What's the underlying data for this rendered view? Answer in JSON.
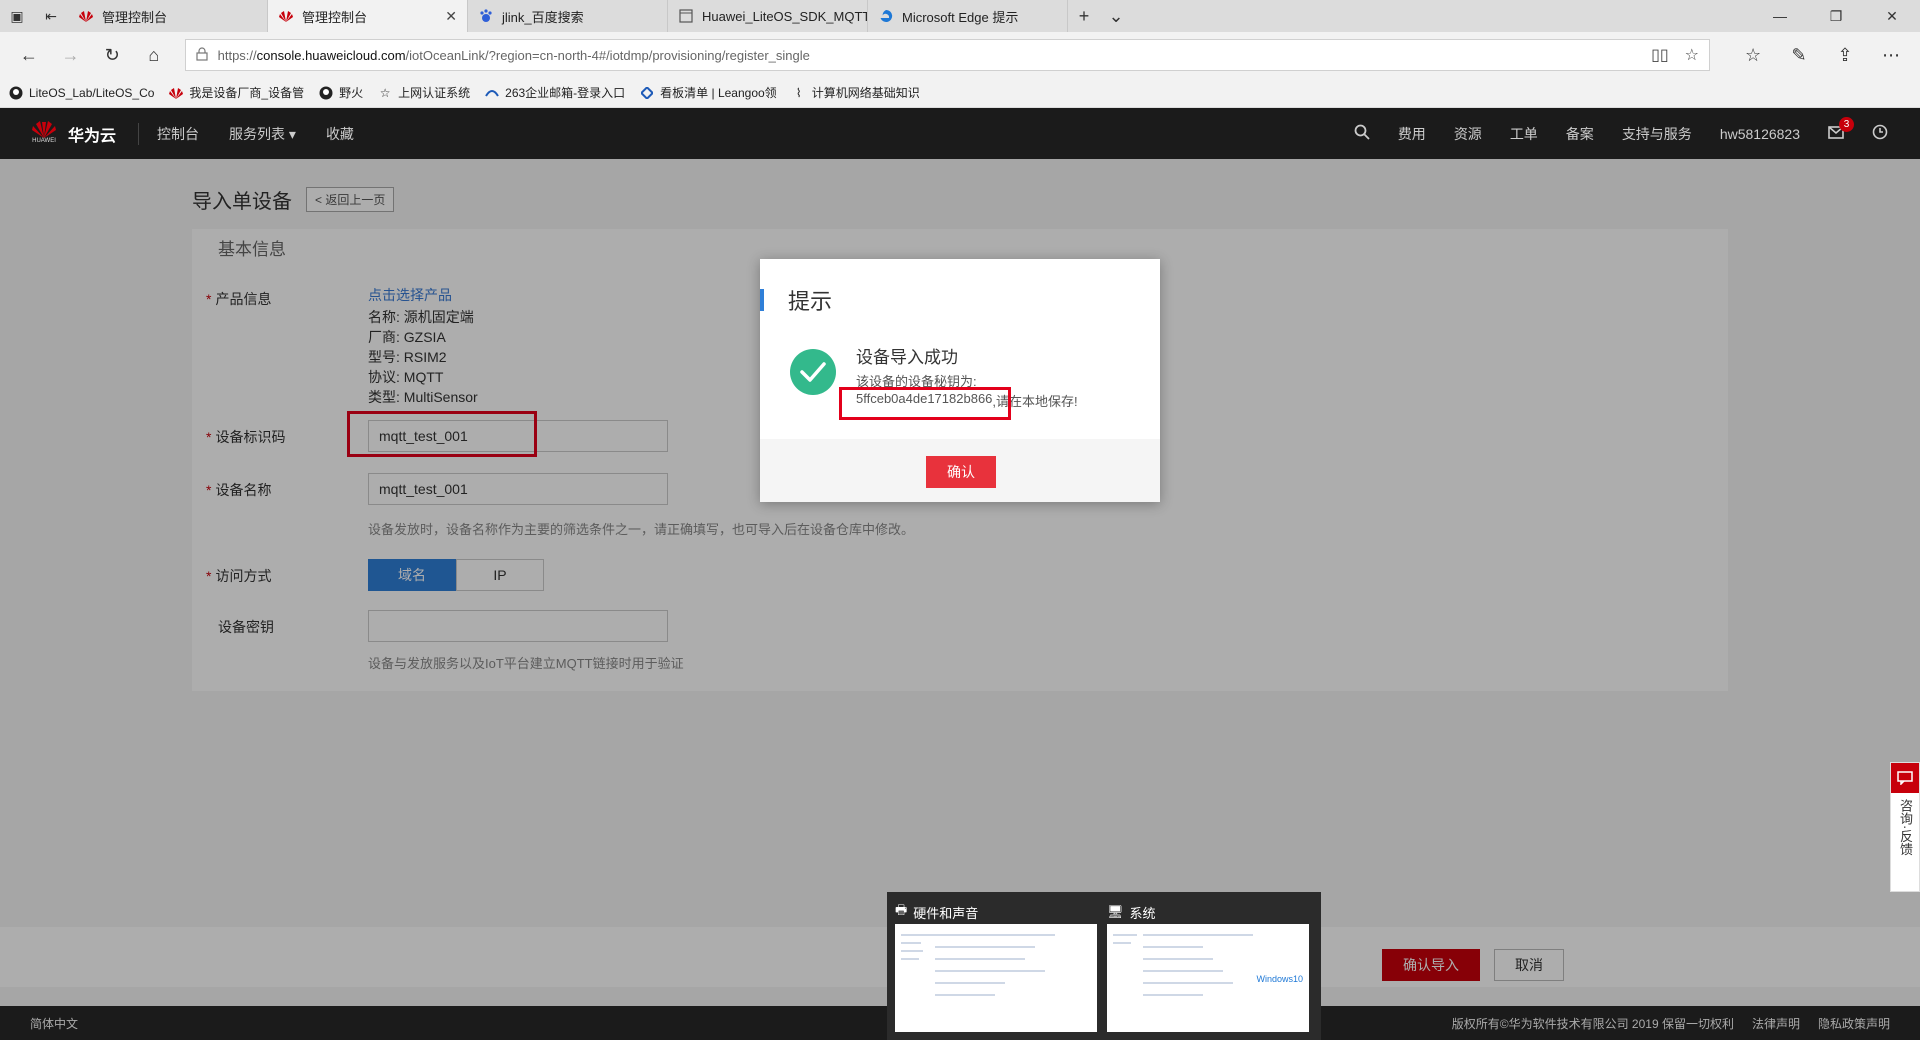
{
  "browser": {
    "tabs": [
      {
        "label": "管理控制台",
        "active": false
      },
      {
        "label": "管理控制台",
        "active": true
      },
      {
        "label": "jlink_百度搜索",
        "active": false
      },
      {
        "label": "Huawei_LiteOS_SDK_MQTT_",
        "active": false
      },
      {
        "label": "Microsoft Edge 提示",
        "active": false
      }
    ],
    "url_prefix": "https://",
    "url_host": "console.huaweicloud.com",
    "url_path": "/iotOceanLink/?region=cn-north-4#/iotdmp/provisioning/register_single",
    "favorites": [
      "LiteOS_Lab/LiteOS_Co",
      "我是设备厂商_设备管",
      "野火",
      "上网认证系统",
      "263企业邮箱-登录入口",
      "看板清单 | Leangoo领",
      "计算机网络基础知识"
    ]
  },
  "header": {
    "brand": "华为云",
    "logo_text": "HUAWEI",
    "menu": [
      "控制台",
      "服务列表 ▾",
      "收藏"
    ],
    "right": [
      "费用",
      "资源",
      "工单",
      "备案",
      "支持与服务",
      "hw58126823"
    ],
    "msg_count": "3"
  },
  "page": {
    "title": "导入单设备",
    "back_label": "< 返回上一页",
    "section_title": "基本信息",
    "product_label": "产品信息",
    "product_link": "点击选择产品",
    "product_details": [
      "名称: 源机固定端",
      "厂商: GZSIA",
      "型号: RSIM2",
      "协议: MQTT",
      "类型: MultiSensor"
    ],
    "device_id_label": "设备标识码",
    "device_id_value": "mqtt_test_001",
    "device_name_label": "设备名称",
    "device_name_value": "mqtt_test_001",
    "device_name_hint": "设备发放时，设备名称作为主要的筛选条件之一，请正确填写，也可导入后在设备仓库中修改。",
    "access_label": "访问方式",
    "access_options": [
      "域名",
      "IP"
    ],
    "secret_label": "设备密钥",
    "secret_value": "",
    "secret_hint": "设备与发放服务以及IoT平台建立MQTT链接时用于验证",
    "confirm_import": "确认导入",
    "cancel": "取消"
  },
  "dialog": {
    "title": "提示",
    "heading": "设备导入成功",
    "message": "该设备的设备秘钥为:",
    "secret_key": "5ffceb0a4de17182b866",
    "save_note": ",请在本地保存!",
    "ok": "确认"
  },
  "consult": {
    "label": "咨询·反馈"
  },
  "footer": {
    "lang": "简体中文",
    "copyright": "版权所有©华为软件技术有限公司 2019 保留一切权利",
    "legal": "法律声明",
    "privacy": "隐私政策声明"
  },
  "taskbar_previews": [
    {
      "title": "硬件和声音"
    },
    {
      "title": "系统",
      "os": "Windows10"
    }
  ],
  "colors": {
    "brand_red": "#c7000b",
    "accent_blue": "#2f7fd8",
    "success_green": "#33b98c",
    "highlight_red": "#e3001b"
  }
}
